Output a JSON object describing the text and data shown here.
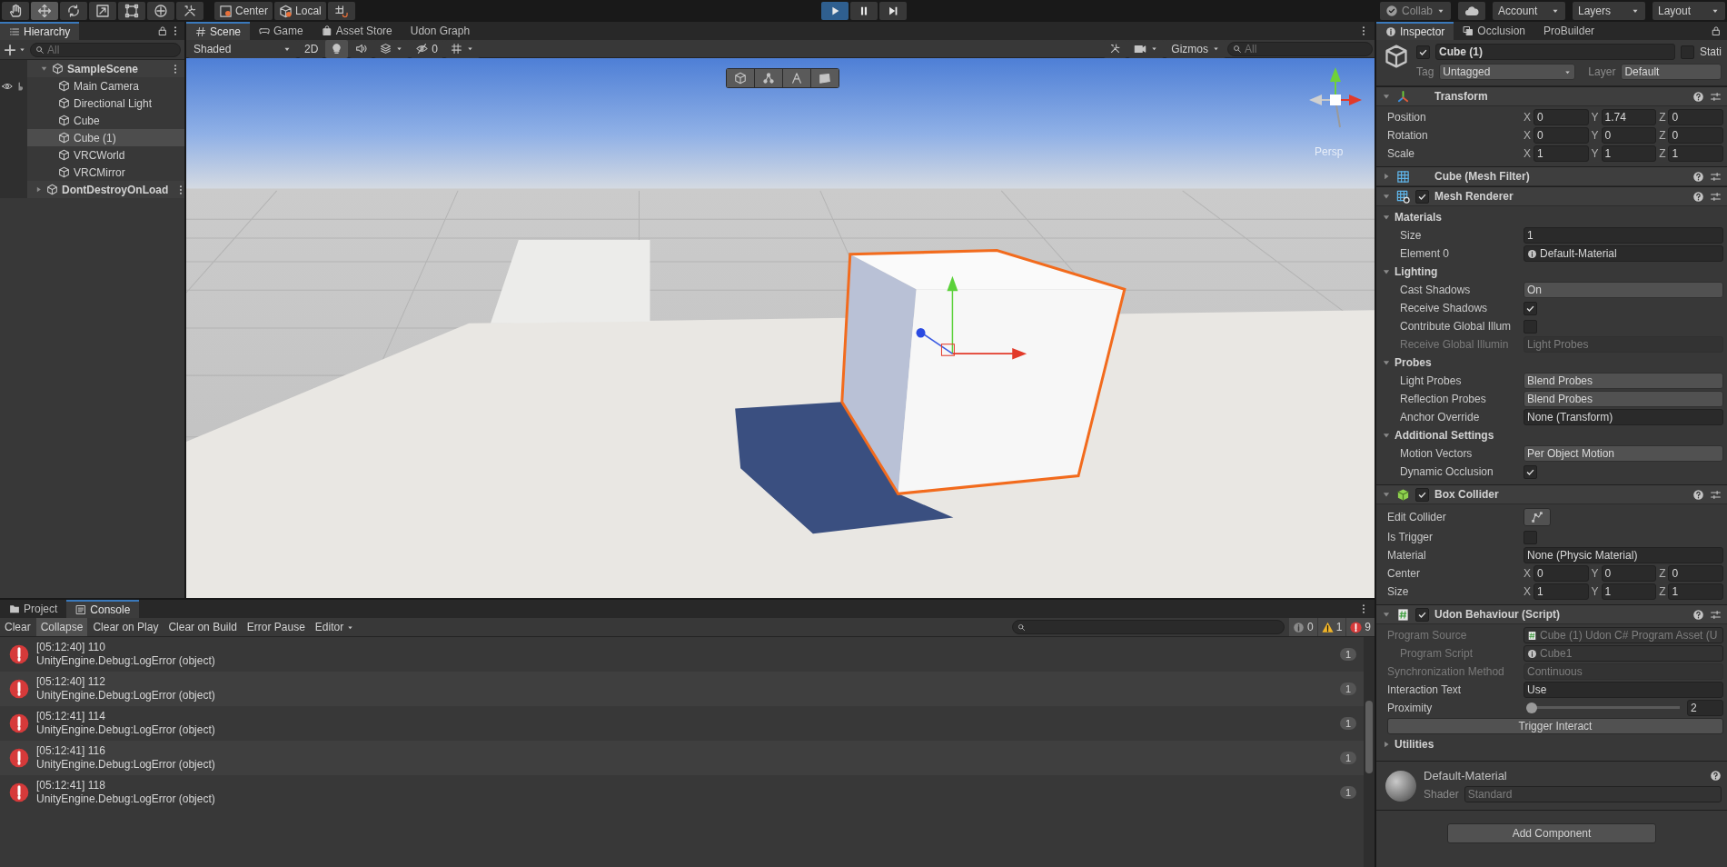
{
  "toolbar": {
    "tools": [
      {
        "kind": "hand",
        "selected": false
      },
      {
        "kind": "move",
        "selected": true
      },
      {
        "kind": "rotate",
        "selected": false
      },
      {
        "kind": "scale",
        "selected": false
      },
      {
        "kind": "rect",
        "selected": false
      },
      {
        "kind": "transform",
        "selected": false
      },
      {
        "kind": "custom",
        "selected": false
      }
    ],
    "pivot": "Center",
    "space": "Local",
    "playing": true,
    "paused": false,
    "collab": "Collab",
    "account": "Account",
    "layers": "Layers",
    "layout": "Layout"
  },
  "hierarchy": {
    "title": "Hierarchy",
    "search_placeholder": "All",
    "scenes": [
      {
        "name": "SampleScene",
        "expanded": true,
        "children": [
          {
            "name": "Main Camera",
            "selected": false,
            "hovered": true
          },
          {
            "name": "Directional Light",
            "selected": false,
            "hovered": false
          },
          {
            "name": "Cube",
            "selected": false,
            "hovered": false
          },
          {
            "name": "Cube (1)",
            "selected": true,
            "hovered": false
          },
          {
            "name": "VRCWorld",
            "selected": false,
            "hovered": false
          },
          {
            "name": "VRCMirror",
            "selected": false,
            "hovered": false
          }
        ]
      },
      {
        "name": "DontDestroyOnLoad",
        "expanded": false
      }
    ]
  },
  "scene_view": {
    "tabs": [
      {
        "label": "Scene",
        "selected": true
      },
      {
        "label": "Game",
        "selected": false
      },
      {
        "label": "Asset Store",
        "selected": false
      },
      {
        "label": "Udon Graph",
        "selected": false
      }
    ],
    "shading": "Shaded",
    "mode_2d": "2D",
    "hidden_count": "0",
    "gizmos": "Gizmos",
    "search_placeholder": "All",
    "camera_label": "Persp"
  },
  "inspector": {
    "tabs": [
      {
        "label": "Inspector",
        "selected": true
      },
      {
        "label": "Occlusion",
        "selected": false
      },
      {
        "label": "ProBuilder",
        "selected": false
      }
    ],
    "object": {
      "name": "Cube (1)",
      "active": true,
      "static_label": "Stati",
      "static": false,
      "tag_label": "Tag",
      "tag": "Untagged",
      "layer_label": "Layer",
      "layer": "Default"
    },
    "components": [
      {
        "title": "Transform",
        "expanded": true,
        "fields": [
          {
            "kind": "vector",
            "label": "Position",
            "values": [
              {
                "axis": "X",
                "value": "0"
              },
              {
                "axis": "Y",
                "value": "1.74"
              },
              {
                "axis": "Z",
                "value": "0"
              }
            ]
          },
          {
            "kind": "vector",
            "label": "Rotation",
            "values": [
              {
                "axis": "X",
                "value": "0"
              },
              {
                "axis": "Y",
                "value": "0"
              },
              {
                "axis": "Z",
                "value": "0"
              }
            ]
          },
          {
            "kind": "vector",
            "label": "Scale",
            "values": [
              {
                "axis": "X",
                "value": "1"
              },
              {
                "axis": "Y",
                "value": "1"
              },
              {
                "axis": "Z",
                "value": "1"
              }
            ]
          }
        ]
      },
      {
        "title": "Cube (Mesh Filter)",
        "expanded": false
      },
      {
        "title": "Mesh Renderer",
        "expanded": true,
        "enabled": true,
        "fields": [
          {
            "kind": "section",
            "label": "Materials",
            "expanded": true,
            "children": [
              {
                "kind": "text",
                "label": "Size",
                "value": "1"
              },
              {
                "kind": "object",
                "label": "Element 0",
                "value": "Default-Material",
                "assigned": true
              }
            ]
          },
          {
            "kind": "section",
            "label": "Lighting",
            "expanded": true,
            "children": [
              {
                "kind": "dropdown",
                "label": "Cast Shadows",
                "value": "On"
              },
              {
                "kind": "checkbox",
                "label": "Receive Shadows",
                "checked": true
              },
              {
                "kind": "checkbox",
                "label": "Contribute Global Illum",
                "checked": false
              },
              {
                "kind": "dropdown",
                "label": "Receive Global Illumin",
                "value": "Light Probes",
                "disabled": true
              }
            ]
          },
          {
            "kind": "section",
            "label": "Probes",
            "expanded": true,
            "children": [
              {
                "kind": "dropdown",
                "label": "Light Probes",
                "value": "Blend Probes"
              },
              {
                "kind": "dropdown",
                "label": "Reflection Probes",
                "value": "Blend Probes"
              },
              {
                "kind": "object",
                "label": "Anchor Override",
                "value": "None (Transform)",
                "assigned": false
              }
            ]
          },
          {
            "kind": "section",
            "label": "Additional Settings",
            "expanded": true,
            "children": [
              {
                "kind": "dropdown",
                "label": "Motion Vectors",
                "value": "Per Object Motion"
              },
              {
                "kind": "checkbox",
                "label": "Dynamic Occlusion",
                "checked": true
              }
            ]
          }
        ]
      },
      {
        "title": "Box Collider",
        "expanded": true,
        "enabled": true,
        "fields": [
          {
            "kind": "edit_button",
            "label": "Edit Collider"
          },
          {
            "kind": "checkbox",
            "label": "Is Trigger",
            "checked": false
          },
          {
            "kind": "object",
            "label": "Material",
            "value": "None (Physic Material)",
            "assigned": false
          },
          {
            "kind": "vector",
            "label": "Center",
            "values": [
              {
                "axis": "X",
                "value": "0"
              },
              {
                "axis": "Y",
                "value": "0"
              },
              {
                "axis": "Z",
                "value": "0"
              }
            ]
          },
          {
            "kind": "vector",
            "label": "Size",
            "values": [
              {
                "axis": "X",
                "value": "1"
              },
              {
                "axis": "Y",
                "value": "1"
              },
              {
                "axis": "Z",
                "value": "1"
              }
            ]
          }
        ]
      },
      {
        "title": "Udon Behaviour (Script)",
        "expanded": true,
        "enabled": true,
        "fields": [
          {
            "kind": "object",
            "label": "Program Source",
            "value": "Cube (1) Udon C# Program Asset (U",
            "assigned": true,
            "disabled": true,
            "children": [
              {
                "kind": "object",
                "label": "Program Script",
                "value": "Cube1",
                "assigned": true,
                "disabled": true
              }
            ]
          },
          {
            "kind": "dropdown",
            "label": "Synchronization Method",
            "value": "Continuous",
            "disabled": true
          },
          {
            "kind": "text",
            "label": "Interaction Text",
            "value": "Use"
          },
          {
            "kind": "slider",
            "label": "Proximity",
            "level": 0.02,
            "value": "2"
          },
          {
            "kind": "button",
            "label": "Trigger Interact"
          },
          {
            "kind": "section",
            "label": "Utilities",
            "expanded": false
          }
        ]
      }
    ],
    "material": {
      "name": "Default-Material",
      "shader_label": "Shader",
      "shader": "Standard"
    },
    "add_component": "Add Component"
  },
  "console": {
    "tabs": [
      {
        "label": "Project",
        "selected": false
      },
      {
        "label": "Console",
        "selected": true
      }
    ],
    "buttons": [
      {
        "label": "Clear",
        "on": false
      },
      {
        "label": "Collapse",
        "on": true
      },
      {
        "label": "Clear on Play",
        "on": false
      },
      {
        "label": "Clear on Build",
        "on": false
      },
      {
        "label": "Error Pause",
        "on": false
      }
    ],
    "editor_dropdown": "Editor",
    "info_count": "0",
    "warning_count": "1",
    "error_count": "9",
    "entries": [
      {
        "time": "[05:12:40] 110",
        "message": "UnityEngine.Debug:LogError (object)",
        "count": "1"
      },
      {
        "time": "[05:12:40] 112",
        "message": "UnityEngine.Debug:LogError (object)",
        "count": "1"
      },
      {
        "time": "[05:12:41] 114",
        "message": "UnityEngine.Debug:LogError (object)",
        "count": "1"
      },
      {
        "time": "[05:12:41] 116",
        "message": "UnityEngine.Debug:LogError (object)",
        "count": "1"
      },
      {
        "time": "[05:12:41] 118",
        "message": "UnityEngine.Debug:LogError (object)",
        "count": "1"
      }
    ]
  }
}
